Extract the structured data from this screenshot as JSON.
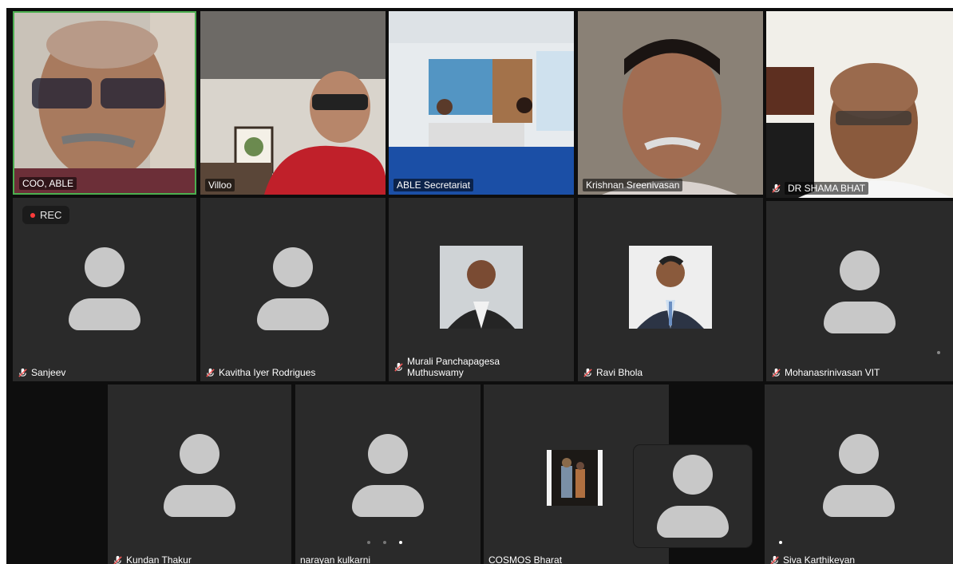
{
  "meeting": {
    "rec_label": "REC",
    "participants": [
      {
        "name": "COO, ABLE",
        "muted": false,
        "video": true,
        "active_speaker": true
      },
      {
        "name": "Villoo",
        "muted": false,
        "video": true
      },
      {
        "name": "ABLE Secretariat",
        "muted": false,
        "video": true
      },
      {
        "name": "Krishnan Sreenivasan",
        "muted": false,
        "video": true
      },
      {
        "name": "DR SHAMA BHAT",
        "muted": true,
        "video": true
      },
      {
        "name": "Sanjeev",
        "muted": true,
        "video": false
      },
      {
        "name": "Kavitha Iyer Rodrigues",
        "muted": true,
        "video": false
      },
      {
        "name": "Murali Panchapagesa Muthuswamy",
        "muted": true,
        "video": false
      },
      {
        "name": "Ravi Bhola",
        "muted": true,
        "video": false
      },
      {
        "name": "Mohanasrinivasan VIT",
        "muted": true,
        "video": false
      },
      {
        "name": "Kundan Thakur",
        "muted": true,
        "video": false
      },
      {
        "name": "narayan kulkarni",
        "muted": false,
        "video": false
      },
      {
        "name": "COSMOS Bharat",
        "muted": false,
        "video": false
      },
      {
        "name": "Siva Karthikeyan",
        "muted": true,
        "video": false
      }
    ]
  },
  "colors": {
    "active_border": "#4caf50",
    "tile_bg": "#2a2a2a",
    "avatar": "#c8c8c8",
    "rec_dot": "#ff3b3b"
  },
  "pagination": {
    "pages": 3,
    "current": 3
  }
}
